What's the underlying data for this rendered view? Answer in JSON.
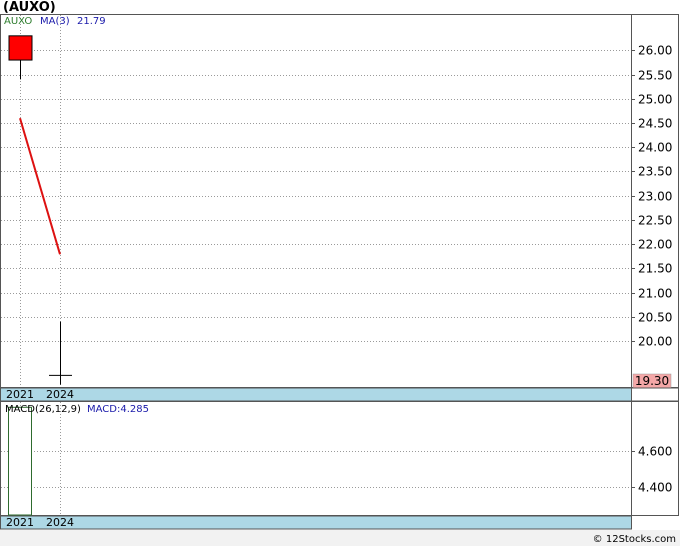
{
  "ticker_title": "(AUXO)",
  "legend": {
    "symbol": "AUXO",
    "ma_label": "MA(3)",
    "ma_value": "21.79"
  },
  "macd_legend": {
    "label": "MACD(26,12,9)",
    "value_label": "MACD:4.285"
  },
  "last_price_tag": "19.30",
  "footer": "© 12Stocks.com",
  "colors": {
    "up_candle": "#ff0000",
    "ma_line": "#dd1111",
    "axis_band": "#add8e6",
    "price_tag": "#f4a7a7",
    "macd_bar": "#2e6b2e",
    "legend_symbol": "#2e7d2e",
    "legend_ma": "#1a1aaa"
  },
  "chart_data": [
    {
      "type": "candlestick",
      "categories": [
        "2021",
        "2024"
      ],
      "x_tick_labels": [
        "2021",
        "2024"
      ],
      "candles": [
        {
          "x": "2021",
          "open": 25.8,
          "close": 26.3,
          "high": 26.3,
          "low": 25.4
        },
        {
          "x": "2024",
          "open": 19.3,
          "close": 19.3,
          "high": 20.4,
          "low": 19.1
        }
      ],
      "series": [
        {
          "name": "MA(3)",
          "type": "line",
          "values": [
            24.6,
            21.79
          ]
        }
      ],
      "yticks": [
        20.0,
        20.5,
        21.0,
        21.5,
        22.0,
        22.5,
        23.0,
        23.5,
        24.0,
        24.5,
        25.0,
        25.5,
        26.0
      ],
      "ylim": [
        19.05,
        26.73
      ],
      "last_value": 19.3,
      "grid": true,
      "y_axis_side": "right"
    },
    {
      "type": "bar",
      "categories": [
        "2021",
        "2024"
      ],
      "x_tick_labels": [
        "2021",
        "2024"
      ],
      "series": [
        {
          "name": "MACD(26,12,9)",
          "values": [
            4.85,
            null
          ]
        }
      ],
      "yticks": [
        4.4,
        4.6
      ],
      "ylim": [
        4.24,
        4.88
      ],
      "grid": true,
      "y_axis_side": "right"
    }
  ]
}
